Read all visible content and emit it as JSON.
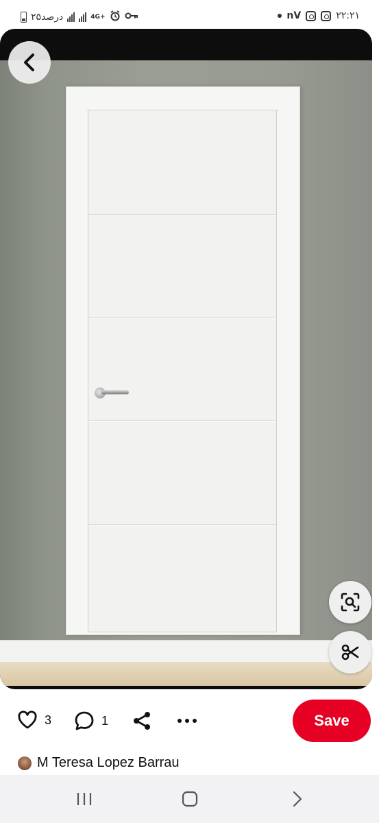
{
  "status_bar": {
    "battery_text": "٢۵درصد",
    "network_type": "4G+",
    "app_badge": "nV",
    "time": "٢٢:٢١"
  },
  "pin": {
    "image_description_icon": "photo-icon",
    "like_count": "3",
    "comment_count": "1",
    "save_label": "Save",
    "author_name": "M Teresa Lopez Barrau"
  },
  "icons": {
    "back": "chevron-left-icon",
    "visual_search": "lens-search-icon",
    "cutout": "scissors-icon",
    "like": "heart-icon",
    "comment": "comment-icon",
    "share": "share-icon",
    "more": "more-dots-icon"
  },
  "colors": {
    "save_button": "#e60023",
    "card_background": "#0d0d0d",
    "nav_background": "#f2f2f4"
  }
}
